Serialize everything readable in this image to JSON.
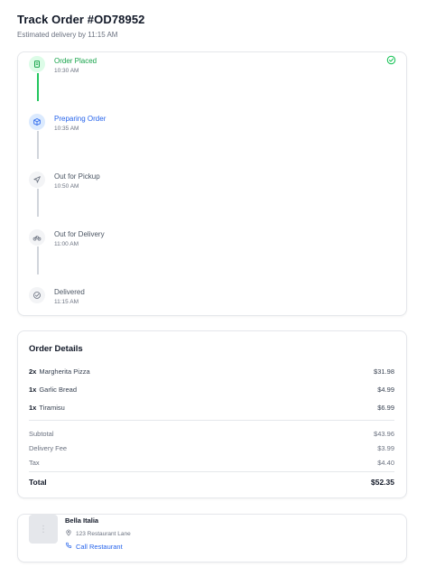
{
  "header": {
    "title": "Track Order #OD78952",
    "subtitle": "Estimated delivery by 11:15 AM"
  },
  "timeline": {
    "steps": [
      {
        "label": "Order Placed",
        "time": "10:30 AM",
        "status": "done",
        "icon": "receipt-icon"
      },
      {
        "label": "Preparing Order",
        "time": "10:35 AM",
        "status": "active",
        "icon": "package-icon"
      },
      {
        "label": "Out for Pickup",
        "time": "10:50 AM",
        "status": "pending",
        "icon": "navigation-icon"
      },
      {
        "label": "Out for Delivery",
        "time": "11:00 AM",
        "status": "pending",
        "icon": "bike-icon"
      },
      {
        "label": "Delivered",
        "time": "11:15 AM",
        "status": "pending",
        "icon": "check-circle-icon"
      }
    ]
  },
  "order": {
    "title": "Order Details",
    "items": [
      {
        "qty": "2x",
        "name": "Margherita Pizza",
        "price": "$31.98"
      },
      {
        "qty": "1x",
        "name": "Garlic Bread",
        "price": "$4.99"
      },
      {
        "qty": "1x",
        "name": "Tiramisu",
        "price": "$6.99"
      }
    ],
    "subtotal_label": "Subtotal",
    "subtotal": "$43.96",
    "delivery_label": "Delivery Fee",
    "delivery": "$3.99",
    "tax_label": "Tax",
    "tax": "$4.40",
    "total_label": "Total",
    "total": "$52.35"
  },
  "restaurant": {
    "name": "Bella Italia",
    "address": "123 Restaurant Lane",
    "call_label": "Call Restaurant"
  },
  "colors": {
    "done": "#16a34a",
    "active": "#2563eb",
    "pending": "#6b7280"
  }
}
